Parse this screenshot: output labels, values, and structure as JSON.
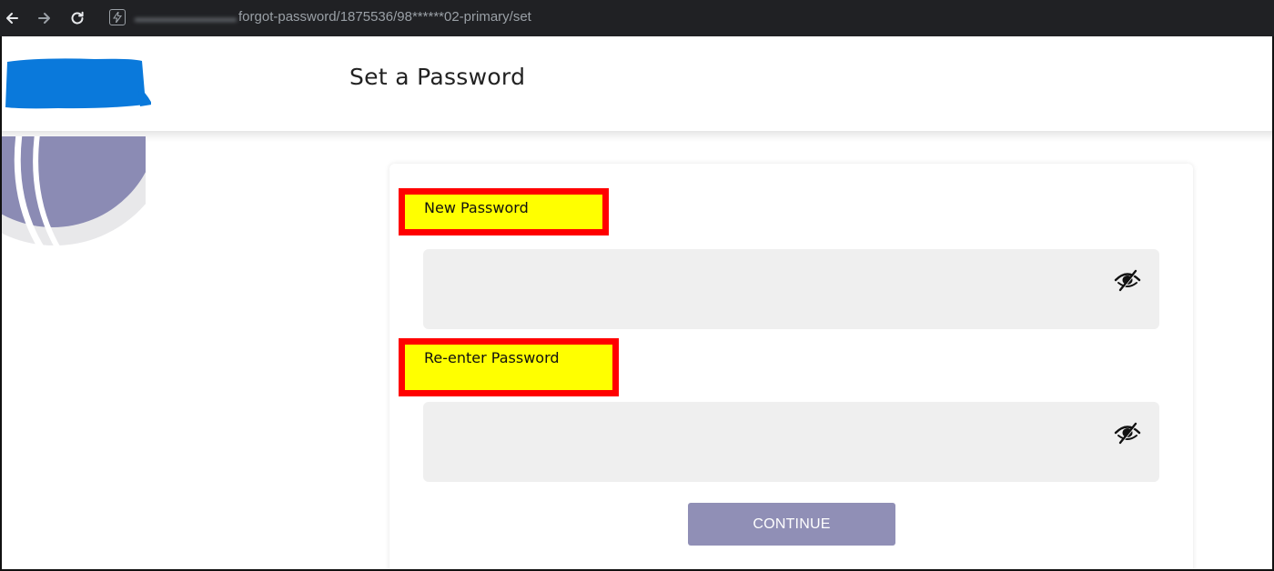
{
  "browser": {
    "back_icon": "back-arrow-icon",
    "forward_icon": "forward-arrow-icon",
    "reload_icon": "reload-icon",
    "site_icon": "site-info-icon",
    "url_path": "forgot-password/1875536/98******02-primary/set"
  },
  "header": {
    "title": "Set a Password"
  },
  "form": {
    "new_password_label": "New Password",
    "reenter_password_label": "Re-enter Password",
    "new_password_value": "",
    "reenter_password_value": "",
    "visibility_icon": "eye-slash-icon",
    "continue_label": "CONTINUE"
  },
  "colors": {
    "browser_bar": "#202124",
    "logo_redaction": "#0a79db",
    "decoration_circle": "#8b8bb4",
    "field_background": "#efefef",
    "button_background": "#908fb6",
    "annotation_border": "#ff0000",
    "annotation_fill": "#ffff00"
  }
}
